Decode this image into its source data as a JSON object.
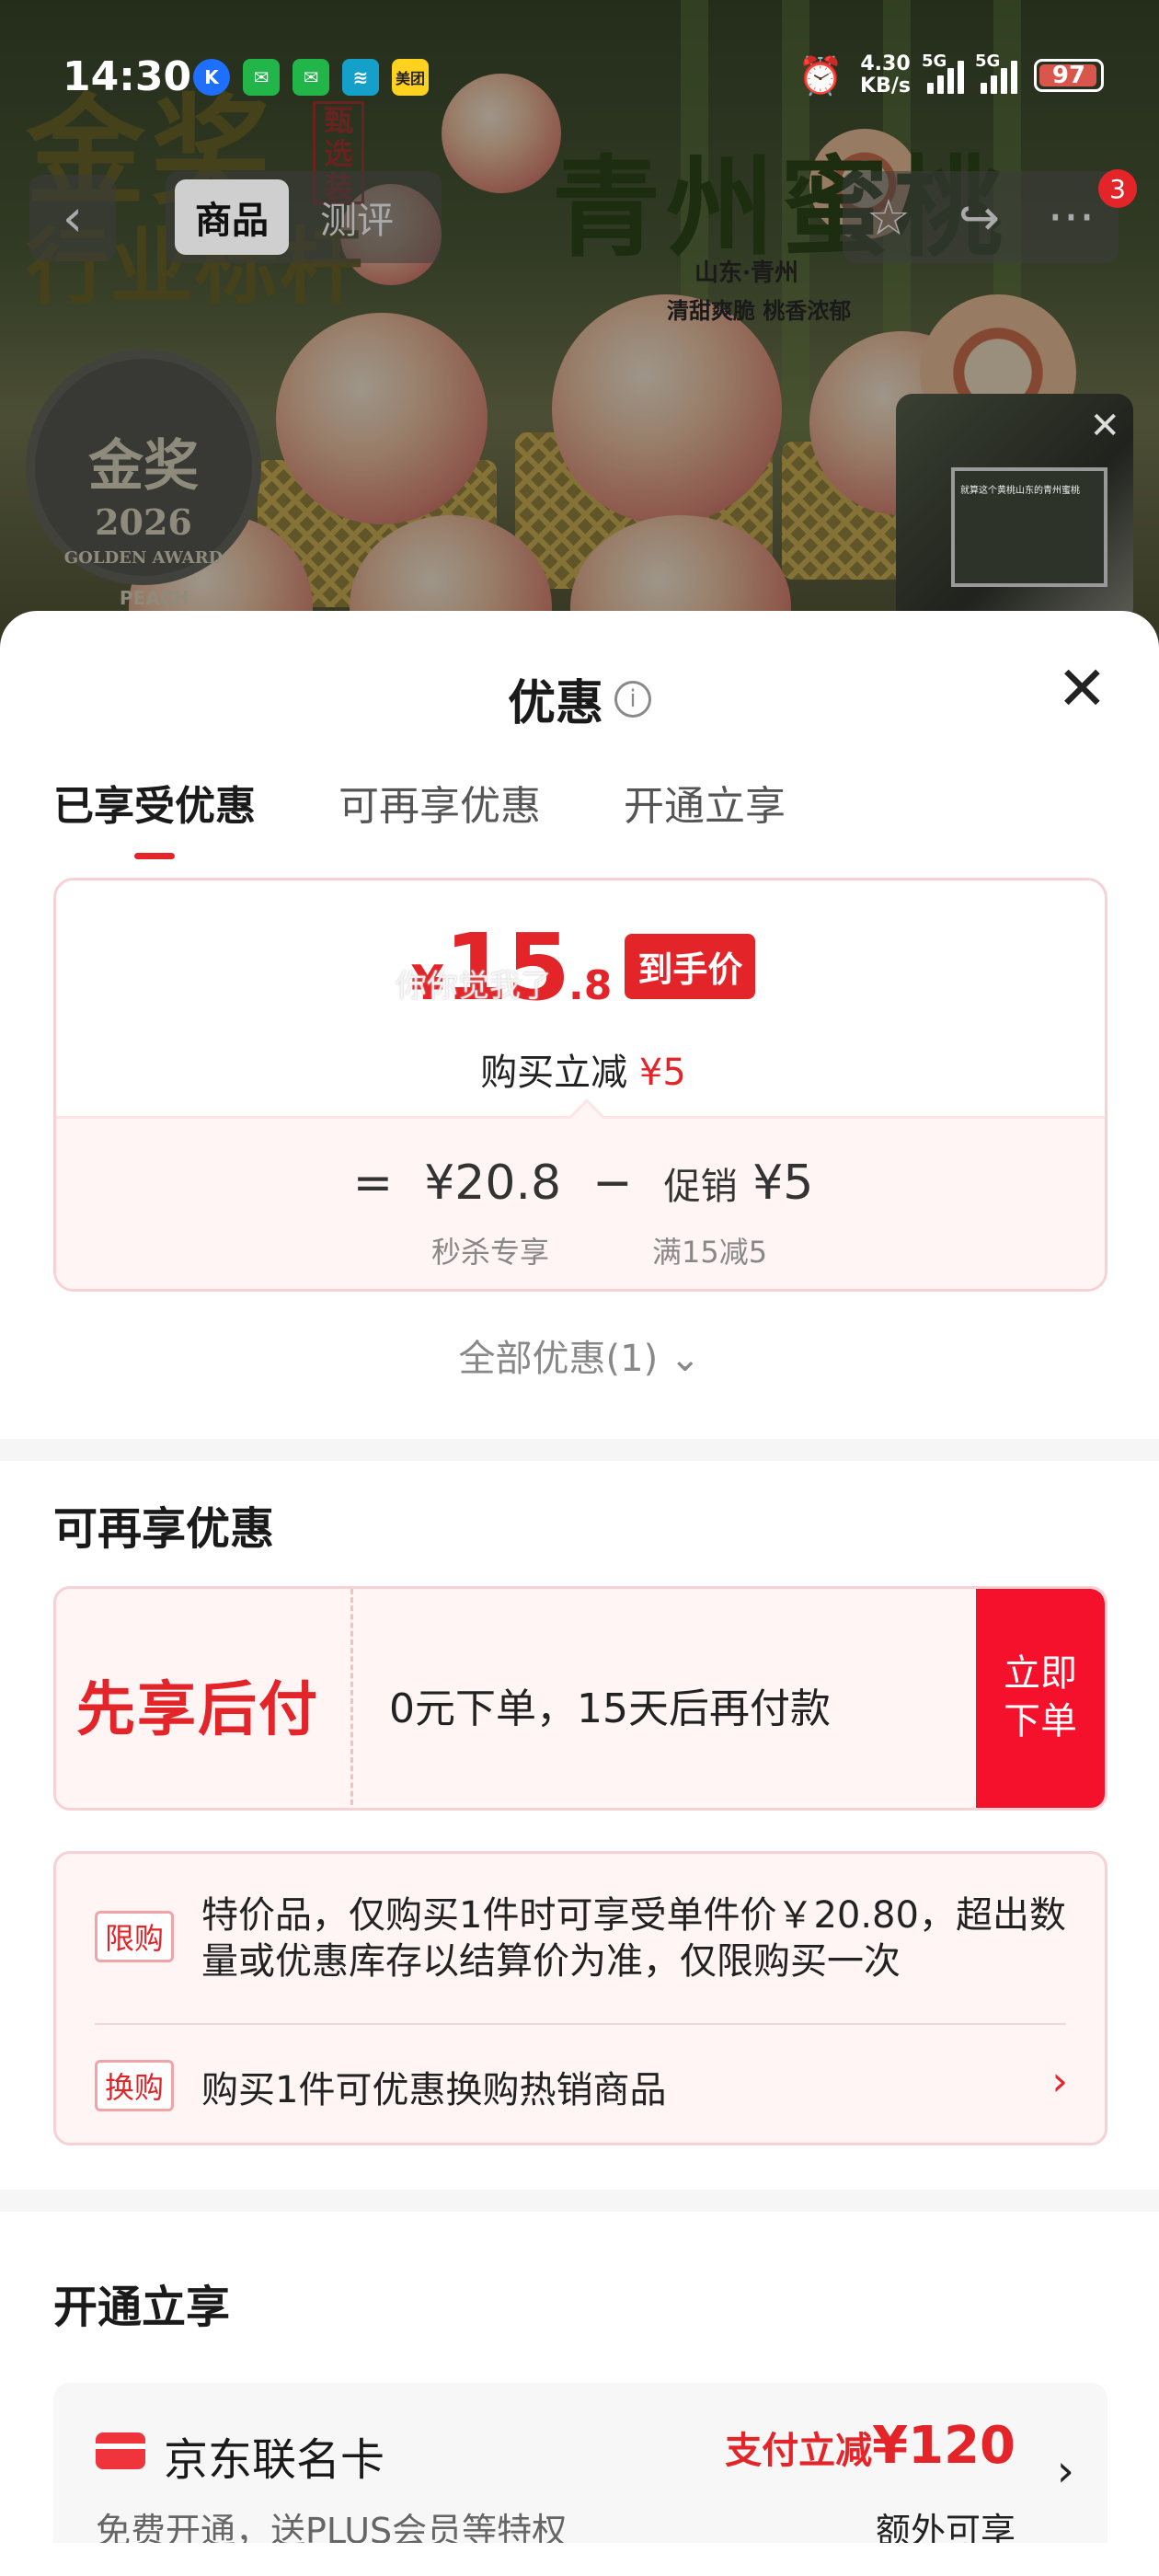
{
  "status_bar": {
    "time": "14:30",
    "net_speed_value": "4.30",
    "net_speed_unit": "KB/s",
    "sim1": "5G",
    "sim2": "5G",
    "battery": "97",
    "apps": [
      "K",
      "",
      "",
      "",
      "美团"
    ]
  },
  "hero": {
    "big_text": "金奖",
    "big_sub": "行业标杆",
    "title": "青州蜜桃",
    "location": "山东·青州",
    "tagline": "清甜爽脆 桃香浓郁",
    "vertical_text": "甄选装",
    "badge_main": "金奖",
    "badge_year": "2026",
    "badge_en": "GOLDEN AWARD",
    "peach_label": "PEACH"
  },
  "nav": {
    "back": "‹",
    "tabs": [
      "商品",
      "测评"
    ],
    "active_tab": 0,
    "star_icon": "☆",
    "share_icon": "↪",
    "more_icon": "···",
    "message_count": "3"
  },
  "mini_video": {
    "close": "✕",
    "caption": "就算这个黄桃山东的青州蜜桃"
  },
  "sheet": {
    "title": "优惠",
    "info_icon": "i",
    "close_icon": "✕",
    "tabs": [
      "已享受优惠",
      "可再享优惠",
      "开通立享"
    ],
    "active_tab": 0,
    "price": {
      "currency": "¥",
      "integer": "15",
      "decimal": ".8",
      "tag": "到手价",
      "desc_prefix": "购买立减",
      "desc_amount": "¥5"
    },
    "formula": {
      "equals": "=",
      "original": "¥20.8",
      "minus": "−",
      "promo_label": "促销",
      "promo_amount": "¥5",
      "original_note": "秒杀专享",
      "promo_note": "满15减5"
    },
    "watermark": "你你觉我了",
    "all_deals": "全部优惠(1)",
    "all_deals_icon": "⌄"
  },
  "more_deals": {
    "title": "可再享优惠",
    "bnpl": {
      "name": "先享后付",
      "desc": "0元下单，15天后再付款",
      "button_line1": "立即",
      "button_line2": "下单"
    },
    "limit": {
      "tag": "限购",
      "text": "特价品，仅购买1件时可享受单件价￥20.80，超出数量或优惠库存以结算价为准，仅限购买一次"
    },
    "swap": {
      "tag": "换购",
      "text": "购买1件可优惠换购热销商品",
      "arrow": "›"
    }
  },
  "instant": {
    "title": "开通立享",
    "card": {
      "name": "京东联名卡",
      "sub": "免费开通，送PLUS会员等特权",
      "promo_label": "支付立减",
      "promo_value": "¥120",
      "extra": "额外可享",
      "arrow": "›"
    }
  },
  "colors": {
    "accent": "#e3252a",
    "button_red": "#f5102c",
    "card_border": "#f6d2d4",
    "card_bg": "#fff5f5"
  }
}
